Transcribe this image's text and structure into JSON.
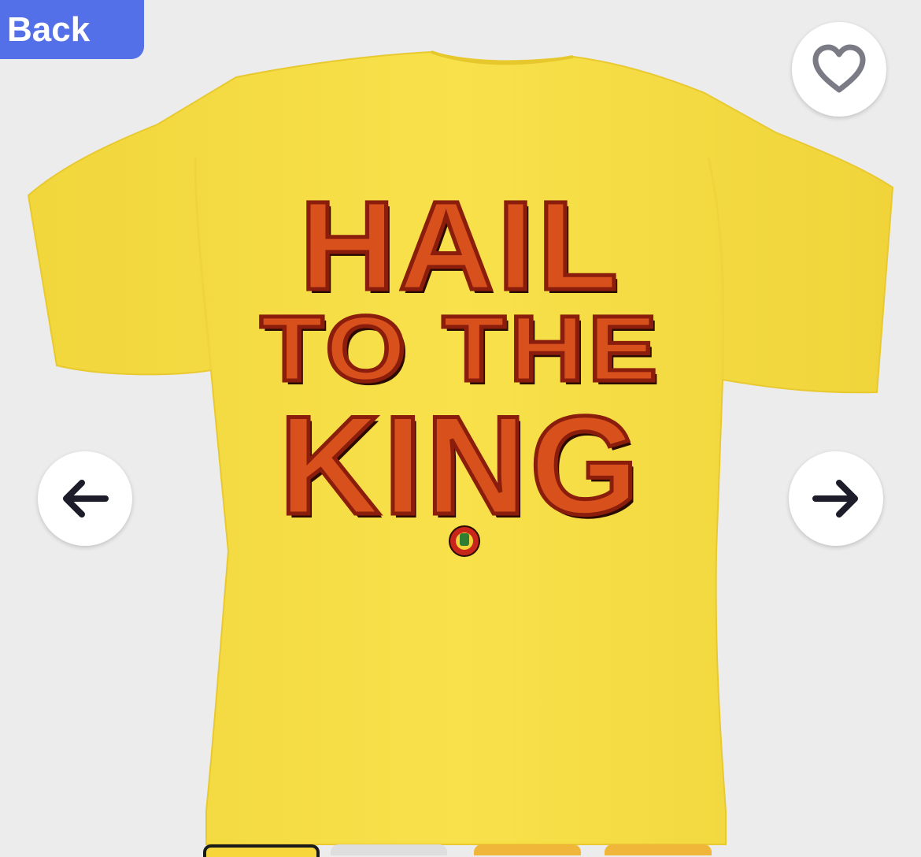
{
  "nav": {
    "back_label": "Back"
  },
  "product": {
    "design_lines": [
      "HAIL",
      "TO THE",
      "KING"
    ],
    "shirt_color": "#f6dd46",
    "text_color": "#d8501b"
  },
  "controls": {
    "favorite_icon": "heart-icon",
    "prev_icon": "arrow-left-icon",
    "next_icon": "arrow-right-icon"
  },
  "colors": {
    "back_button": "#5470e8",
    "background": "#ececec"
  }
}
